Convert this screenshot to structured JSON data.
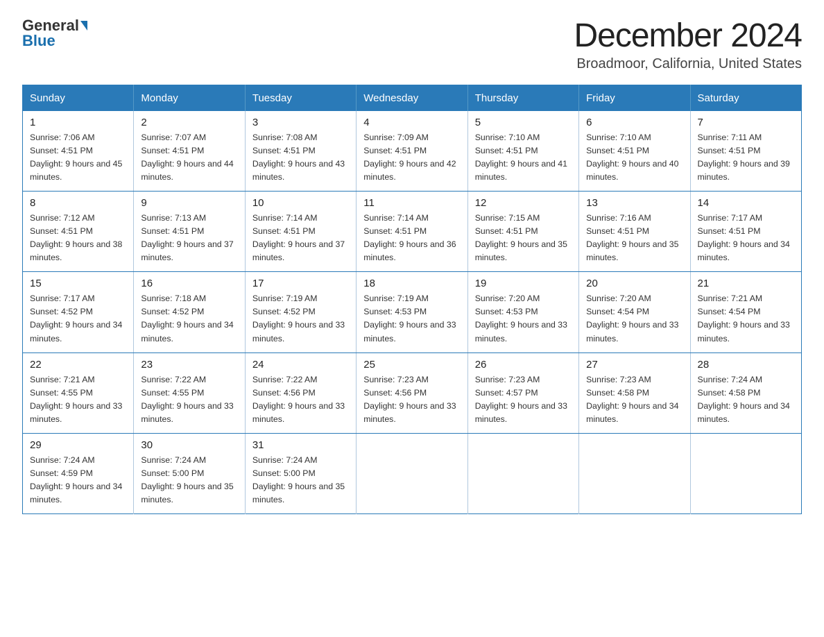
{
  "header": {
    "logo_general": "General",
    "logo_blue": "Blue",
    "month_title": "December 2024",
    "location": "Broadmoor, California, United States"
  },
  "days_of_week": [
    "Sunday",
    "Monday",
    "Tuesday",
    "Wednesday",
    "Thursday",
    "Friday",
    "Saturday"
  ],
  "weeks": [
    [
      {
        "day": "1",
        "sunrise": "7:06 AM",
        "sunset": "4:51 PM",
        "daylight": "9 hours and 45 minutes."
      },
      {
        "day": "2",
        "sunrise": "7:07 AM",
        "sunset": "4:51 PM",
        "daylight": "9 hours and 44 minutes."
      },
      {
        "day": "3",
        "sunrise": "7:08 AM",
        "sunset": "4:51 PM",
        "daylight": "9 hours and 43 minutes."
      },
      {
        "day": "4",
        "sunrise": "7:09 AM",
        "sunset": "4:51 PM",
        "daylight": "9 hours and 42 minutes."
      },
      {
        "day": "5",
        "sunrise": "7:10 AM",
        "sunset": "4:51 PM",
        "daylight": "9 hours and 41 minutes."
      },
      {
        "day": "6",
        "sunrise": "7:10 AM",
        "sunset": "4:51 PM",
        "daylight": "9 hours and 40 minutes."
      },
      {
        "day": "7",
        "sunrise": "7:11 AM",
        "sunset": "4:51 PM",
        "daylight": "9 hours and 39 minutes."
      }
    ],
    [
      {
        "day": "8",
        "sunrise": "7:12 AM",
        "sunset": "4:51 PM",
        "daylight": "9 hours and 38 minutes."
      },
      {
        "day": "9",
        "sunrise": "7:13 AM",
        "sunset": "4:51 PM",
        "daylight": "9 hours and 37 minutes."
      },
      {
        "day": "10",
        "sunrise": "7:14 AM",
        "sunset": "4:51 PM",
        "daylight": "9 hours and 37 minutes."
      },
      {
        "day": "11",
        "sunrise": "7:14 AM",
        "sunset": "4:51 PM",
        "daylight": "9 hours and 36 minutes."
      },
      {
        "day": "12",
        "sunrise": "7:15 AM",
        "sunset": "4:51 PM",
        "daylight": "9 hours and 35 minutes."
      },
      {
        "day": "13",
        "sunrise": "7:16 AM",
        "sunset": "4:51 PM",
        "daylight": "9 hours and 35 minutes."
      },
      {
        "day": "14",
        "sunrise": "7:17 AM",
        "sunset": "4:51 PM",
        "daylight": "9 hours and 34 minutes."
      }
    ],
    [
      {
        "day": "15",
        "sunrise": "7:17 AM",
        "sunset": "4:52 PM",
        "daylight": "9 hours and 34 minutes."
      },
      {
        "day": "16",
        "sunrise": "7:18 AM",
        "sunset": "4:52 PM",
        "daylight": "9 hours and 34 minutes."
      },
      {
        "day": "17",
        "sunrise": "7:19 AM",
        "sunset": "4:52 PM",
        "daylight": "9 hours and 33 minutes."
      },
      {
        "day": "18",
        "sunrise": "7:19 AM",
        "sunset": "4:53 PM",
        "daylight": "9 hours and 33 minutes."
      },
      {
        "day": "19",
        "sunrise": "7:20 AM",
        "sunset": "4:53 PM",
        "daylight": "9 hours and 33 minutes."
      },
      {
        "day": "20",
        "sunrise": "7:20 AM",
        "sunset": "4:54 PM",
        "daylight": "9 hours and 33 minutes."
      },
      {
        "day": "21",
        "sunrise": "7:21 AM",
        "sunset": "4:54 PM",
        "daylight": "9 hours and 33 minutes."
      }
    ],
    [
      {
        "day": "22",
        "sunrise": "7:21 AM",
        "sunset": "4:55 PM",
        "daylight": "9 hours and 33 minutes."
      },
      {
        "day": "23",
        "sunrise": "7:22 AM",
        "sunset": "4:55 PM",
        "daylight": "9 hours and 33 minutes."
      },
      {
        "day": "24",
        "sunrise": "7:22 AM",
        "sunset": "4:56 PM",
        "daylight": "9 hours and 33 minutes."
      },
      {
        "day": "25",
        "sunrise": "7:23 AM",
        "sunset": "4:56 PM",
        "daylight": "9 hours and 33 minutes."
      },
      {
        "day": "26",
        "sunrise": "7:23 AM",
        "sunset": "4:57 PM",
        "daylight": "9 hours and 33 minutes."
      },
      {
        "day": "27",
        "sunrise": "7:23 AM",
        "sunset": "4:58 PM",
        "daylight": "9 hours and 34 minutes."
      },
      {
        "day": "28",
        "sunrise": "7:24 AM",
        "sunset": "4:58 PM",
        "daylight": "9 hours and 34 minutes."
      }
    ],
    [
      {
        "day": "29",
        "sunrise": "7:24 AM",
        "sunset": "4:59 PM",
        "daylight": "9 hours and 34 minutes."
      },
      {
        "day": "30",
        "sunrise": "7:24 AM",
        "sunset": "5:00 PM",
        "daylight": "9 hours and 35 minutes."
      },
      {
        "day": "31",
        "sunrise": "7:24 AM",
        "sunset": "5:00 PM",
        "daylight": "9 hours and 35 minutes."
      },
      null,
      null,
      null,
      null
    ]
  ]
}
